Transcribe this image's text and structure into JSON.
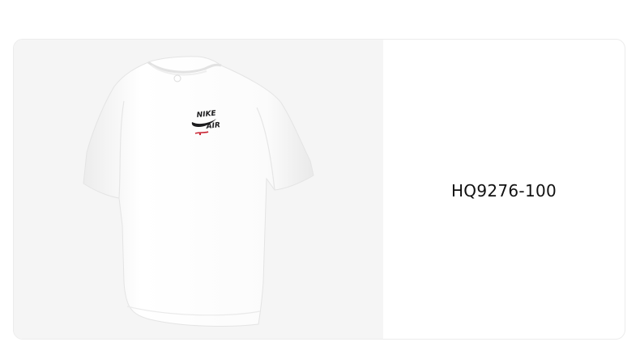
{
  "product": {
    "image_description_icon": "tshirt-product-image",
    "logo_text": "NIKE AIR",
    "sku": "HQ9276-100"
  },
  "colors": {
    "image_background": "#f5f5f5",
    "shirt": "#ffffff",
    "logo_dark": "#1d1d1f",
    "logo_accent": "#c8202f"
  }
}
